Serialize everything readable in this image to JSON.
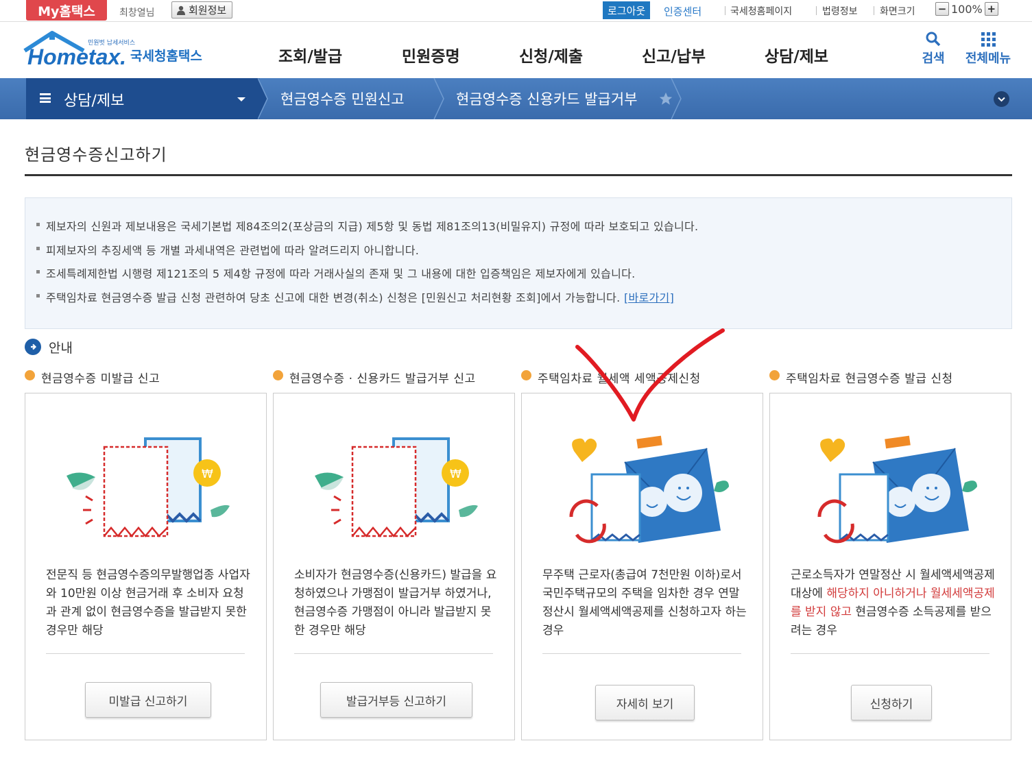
{
  "topbar": {
    "my_hometax": "My홈택스",
    "username": "최창열님",
    "member_info": "회원정보",
    "logout": "로그아웃",
    "cert_center": "인증센터",
    "links": [
      "국세청홈페이지",
      "법령정보",
      "화면크기"
    ],
    "zoom": "100%",
    "zoom_minus": "−",
    "zoom_plus": "+"
  },
  "header": {
    "logo_sub": "민원벗 납세서비스",
    "logo_text": "Hometax.",
    "logo_kr": "국세청홈택스",
    "menu": [
      "조회/발급",
      "민원증명",
      "신청/제출",
      "신고/납부",
      "상담/제보"
    ],
    "search_label": "검색",
    "all_menu_label": "전체메뉴"
  },
  "navbar": {
    "section": "상담/제보",
    "crumbs": [
      "현금영수증 민원신고",
      "현금영수증 신용카드 발급거부"
    ]
  },
  "page_title": "현금영수증신고하기",
  "notices": [
    {
      "text": "제보자의 신원과 제보내용은 국세기본법 제84조의2(포상금의 지급) 제5항 및 동법 제81조의13(비밀유지) 규정에 따라 보호되고 있습니다."
    },
    {
      "text": "피제보자의 추징세액 등 개별 과세내역은 관련법에 따라 알려드리지 아니합니다."
    },
    {
      "text": "조세특례제한법 시행령 제121조의 5 제4항 규정에 따라 거래사실의 존재 및 그 내용에 대한 입증책임은 제보자에게 있습니다."
    },
    {
      "text": "주택임차료 현금영수증 발급 신청 관련하여 당초 신고에 대한 변경(취소) 신청은 [민원신고 처리현황 조회]에서 가능합니다.",
      "link": "[바로가기]"
    }
  ],
  "guide_title": "안내",
  "cards": [
    {
      "title": "현금영수증 미발급 신고",
      "desc": "전문직 등 현금영수증의무발행업종 사업자와 10만원 이상 현금거래 후 소비자 요청과 관계 없이 현금영수증을 발급받지 못한 경우만 해당",
      "button": "미발급 신고하기"
    },
    {
      "title": "현금영수증 · 신용카드 발급거부 신고",
      "desc": "소비자가 현금영수증(신용카드) 발급을 요청하였으나 가맹점이 발급거부 하였거나, 현금영수증 가맹점이 아니라 발급받지 못한 경우만 해당",
      "button": "발급거부등 신고하기"
    },
    {
      "title": "주택임차료 월세액 세액공제신청",
      "desc": "무주택 근로자(총급여 7천만원 이하)로서 국민주택규모의 주택을 임차한 경우 연말정산시 월세액세액공제를 신청하고자 하는 경우",
      "button": "자세히 보기"
    },
    {
      "title": "주택임차료 현금영수증 발급 신청",
      "desc_a": "근로소득자가 연말정산 시 월세액세액공제 대상에 ",
      "desc_red": "해당하지 아니하거나 월세세액공제를 받지 않고",
      "desc_b": " 현금영수증 소득공제를 받으려는 경우",
      "button": "신청하기"
    }
  ],
  "colors": {
    "brand_red": "#e0474c",
    "nav_blue": "#3a6bac",
    "nav_dark": "#1e4d8f",
    "link_blue": "#2c6fbd",
    "bullet_orange": "#f2a33a",
    "annotation_red": "#e11b22"
  }
}
